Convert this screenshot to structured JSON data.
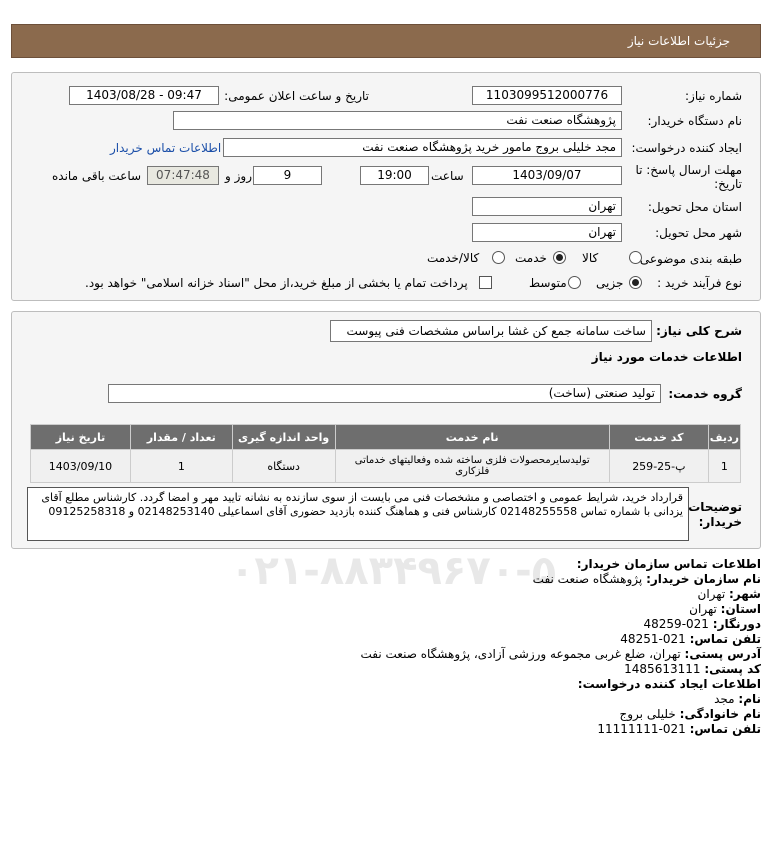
{
  "header": {
    "title": "جزئیات اطلاعات نیاز"
  },
  "need_number": {
    "label": "شماره نیاز:",
    "value": "1103099512000776"
  },
  "announce": {
    "label": "تاریخ و ساعت اعلان عمومی:",
    "value": "1403/08/28 - 09:47"
  },
  "buyer_org": {
    "label": "نام دستگاه خریدار:",
    "value": "پژوهشگاه صنعت نفت"
  },
  "requester": {
    "label": "ایجاد کننده درخواست:",
    "value": "مجد خلیلی بروج مامور خرید پژوهشگاه صنعت نفت",
    "contact_link": "اطلاعات تماس خریدار"
  },
  "deadline": {
    "label_line1": "مهلت ارسال پاسخ: تا",
    "label_line2": "تاریخ:",
    "date": "1403/09/07",
    "time_label": "ساعت",
    "time": "19:00",
    "days": "9",
    "days_label": "روز و",
    "remaining": "07:47:48",
    "remaining_label": "ساعت باقی مانده"
  },
  "province": {
    "label": "استان محل تحویل:",
    "value": "تهران"
  },
  "city": {
    "label": "شهر محل تحویل:",
    "value": "تهران"
  },
  "category": {
    "label": "طبقه بندی موضوعی:",
    "options": [
      "کالا",
      "خدمت",
      "کالا/خدمت"
    ],
    "selected": "خدمت"
  },
  "process": {
    "label": "نوع فرآیند خرید :",
    "options": [
      "جزیی",
      "متوسط"
    ],
    "selected": "جزیی",
    "payment_text": "پرداخت تمام یا بخشی از مبلغ خرید،از محل \"اسناد خزانه اسلامی\" خواهد بود."
  },
  "description": {
    "label": "شرح کلی نیاز:",
    "value": "ساخت سامانه جمع کن غشا براساس مشخصات فنی پیوست"
  },
  "services_title": "اطلاعات خدمات مورد نیاز",
  "service_group": {
    "label": "گروه خدمت:",
    "value": "تولید صنعتی (ساخت)"
  },
  "table": {
    "headers": [
      "ردیف",
      "کد خدمت",
      "نام خدمت",
      "واحد اندازه گیری",
      "تعداد / مقدار",
      "تاریخ نیاز"
    ],
    "rows": [
      {
        "row": "1",
        "code": "پ-25-259",
        "name": "تولیدسایرمحصولات فلزی ساخته شده وفعالیتهای خدماتی فلزکاری",
        "unit": "دستگاه",
        "qty": "1",
        "date": "1403/09/10"
      }
    ]
  },
  "notes": {
    "label": "توضیحات خریدار:",
    "text": "قرارداد خرید، شرایط عمومی و اختصاصی و مشخصات فنی می بایست از سوی سازنده به نشانه تایید مهر و امضا گردد. کارشناس مطلع آقای یزدانی با شماره تماس 02148255558 کارشناس فنی و هماهنگ کننده بازدید حضوری آقای اسماعیلی 02148253140 و 09125258318"
  },
  "contact": {
    "title": "اطلاعات تماس سازمان خریدار:",
    "org_label": "نام سازمان خریدار:",
    "org": "پژوهشگاه صنعت نفت",
    "city_label": "شهر:",
    "city": "تهران",
    "province_label": "استان:",
    "province": "تهران",
    "fax_label": "دورنگار:",
    "fax": "021-48259",
    "phone_label": "تلفن تماس:",
    "phone": "021-48251",
    "address_label": "آدرس پستی:",
    "address": "تهران، ضلع غربی مجموعه ورزشی آزادی، پژوهشگاه صنعت نفت",
    "postal_label": "کد پستی:",
    "postal": "1485613111",
    "creator_title": "اطلاعات ایجاد کننده درخواست:",
    "name_label": "نام:",
    "name": "مجد",
    "family_label": "نام خانوادگی:",
    "family": "خلیلی بروج",
    "creator_phone_label": "تلفن تماس:",
    "creator_phone": "021-11111111"
  }
}
